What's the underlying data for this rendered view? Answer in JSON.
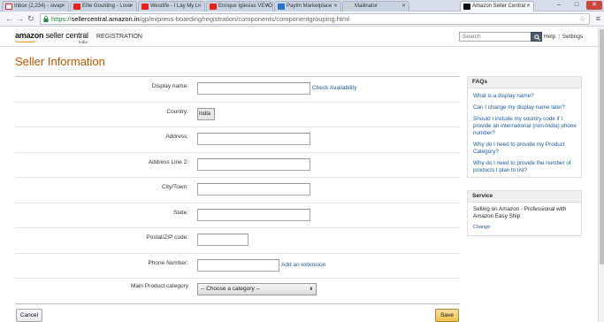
{
  "browser": {
    "tabs": [
      {
        "title": "Inbox (2,234) - sivap",
        "favicon_color": "#d93025"
      },
      {
        "title": "Ellie Goulding - Love",
        "favicon_color": "#e62117"
      },
      {
        "title": "Westlife - I Lay My L",
        "favicon_color": "#e62117"
      },
      {
        "title": "Enrique Iglesias VEVO",
        "favicon_color": "#e62117"
      },
      {
        "title": "Paytm Marketplace",
        "favicon_color": "#2a74c4"
      },
      {
        "title": "Mailinator",
        "favicon_color": "#cfcfcf"
      },
      {
        "title": "Amazon Seller Central",
        "favicon_color": "#111111",
        "active": true
      }
    ],
    "url": {
      "scheme": "https://",
      "host": "sellercentral.amazon.in",
      "path": "/gp/express-boarding/registration/components/componentgrouping.html"
    }
  },
  "header": {
    "logo_main": "amazon",
    "logo_sub": "seller central",
    "logo_region": "India",
    "section": "REGISTRATION",
    "search_placeholder": "Search",
    "help": "Help",
    "separator": "|",
    "settings": "Settings"
  },
  "page": {
    "title": "Seller Information"
  },
  "form": {
    "display_name_label": "Display name:",
    "check_availability": "Check Availability",
    "country_label": "Country:",
    "country_value": "India",
    "address_label": "Address:",
    "address2_label": "Address Line 2:",
    "city_label": "City/Town:",
    "state_label": "State:",
    "postal_label": "Postal/ZIP code:",
    "phone_label": "Phone Number:",
    "add_extension": "Add an extension",
    "category_label": "Main Product category",
    "category_value": "-- Choose a category --"
  },
  "faqs": {
    "heading": "FAQs",
    "items": [
      "What is a display name?",
      "Can I change my display name later?",
      "Should I include my country code if I provide an international (non-India) phone number?",
      "Why do I need to provide my Product Category?",
      "Why do I need to provide the number of products I plan to list?"
    ]
  },
  "service": {
    "heading": "Service",
    "text": "Selling on Amazon - Professional with Amazon Easy Ship",
    "change": "Change"
  },
  "buttons": {
    "cancel": "Cancel",
    "save": "Save"
  },
  "colors": {
    "title": "#c45500",
    "link": "#1a5aa8",
    "save_button": "#f0c14b"
  }
}
